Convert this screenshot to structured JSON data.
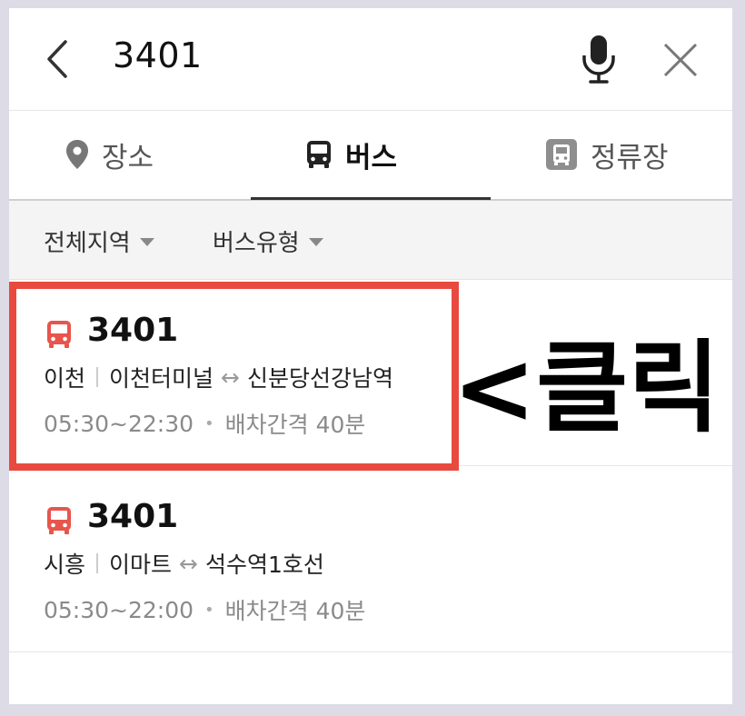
{
  "search": {
    "query": "3401"
  },
  "icons": {
    "back": "chevron-left-icon",
    "mic": "microphone-icon",
    "close": "close-icon",
    "place": "map-pin-icon",
    "bus": "bus-icon",
    "stop": "bus-stop-icon"
  },
  "tabs": [
    {
      "label": "장소",
      "active": false
    },
    {
      "label": "버스",
      "active": true
    },
    {
      "label": "정류장",
      "active": false
    }
  ],
  "filters": {
    "region": "전체지역",
    "bus_type": "버스유형"
  },
  "results": [
    {
      "route": "3401",
      "region": "이천",
      "from": "이천터미널",
      "arrow": "↔",
      "to": "신분당선강남역",
      "hours": "05:30~22:30",
      "interval": "배차간격 40분"
    },
    {
      "route": "3401",
      "region": "시흥",
      "from": "이마트",
      "arrow": "↔",
      "to": "석수역1호선",
      "hours": "05:30~22:00",
      "interval": "배차간격 40분"
    }
  ],
  "annotation": {
    "text": "<클릭"
  },
  "colors": {
    "accent_red": "#e94a3f",
    "bus_icon": "#e8554c",
    "stop_icon": "#8e8e8e"
  }
}
